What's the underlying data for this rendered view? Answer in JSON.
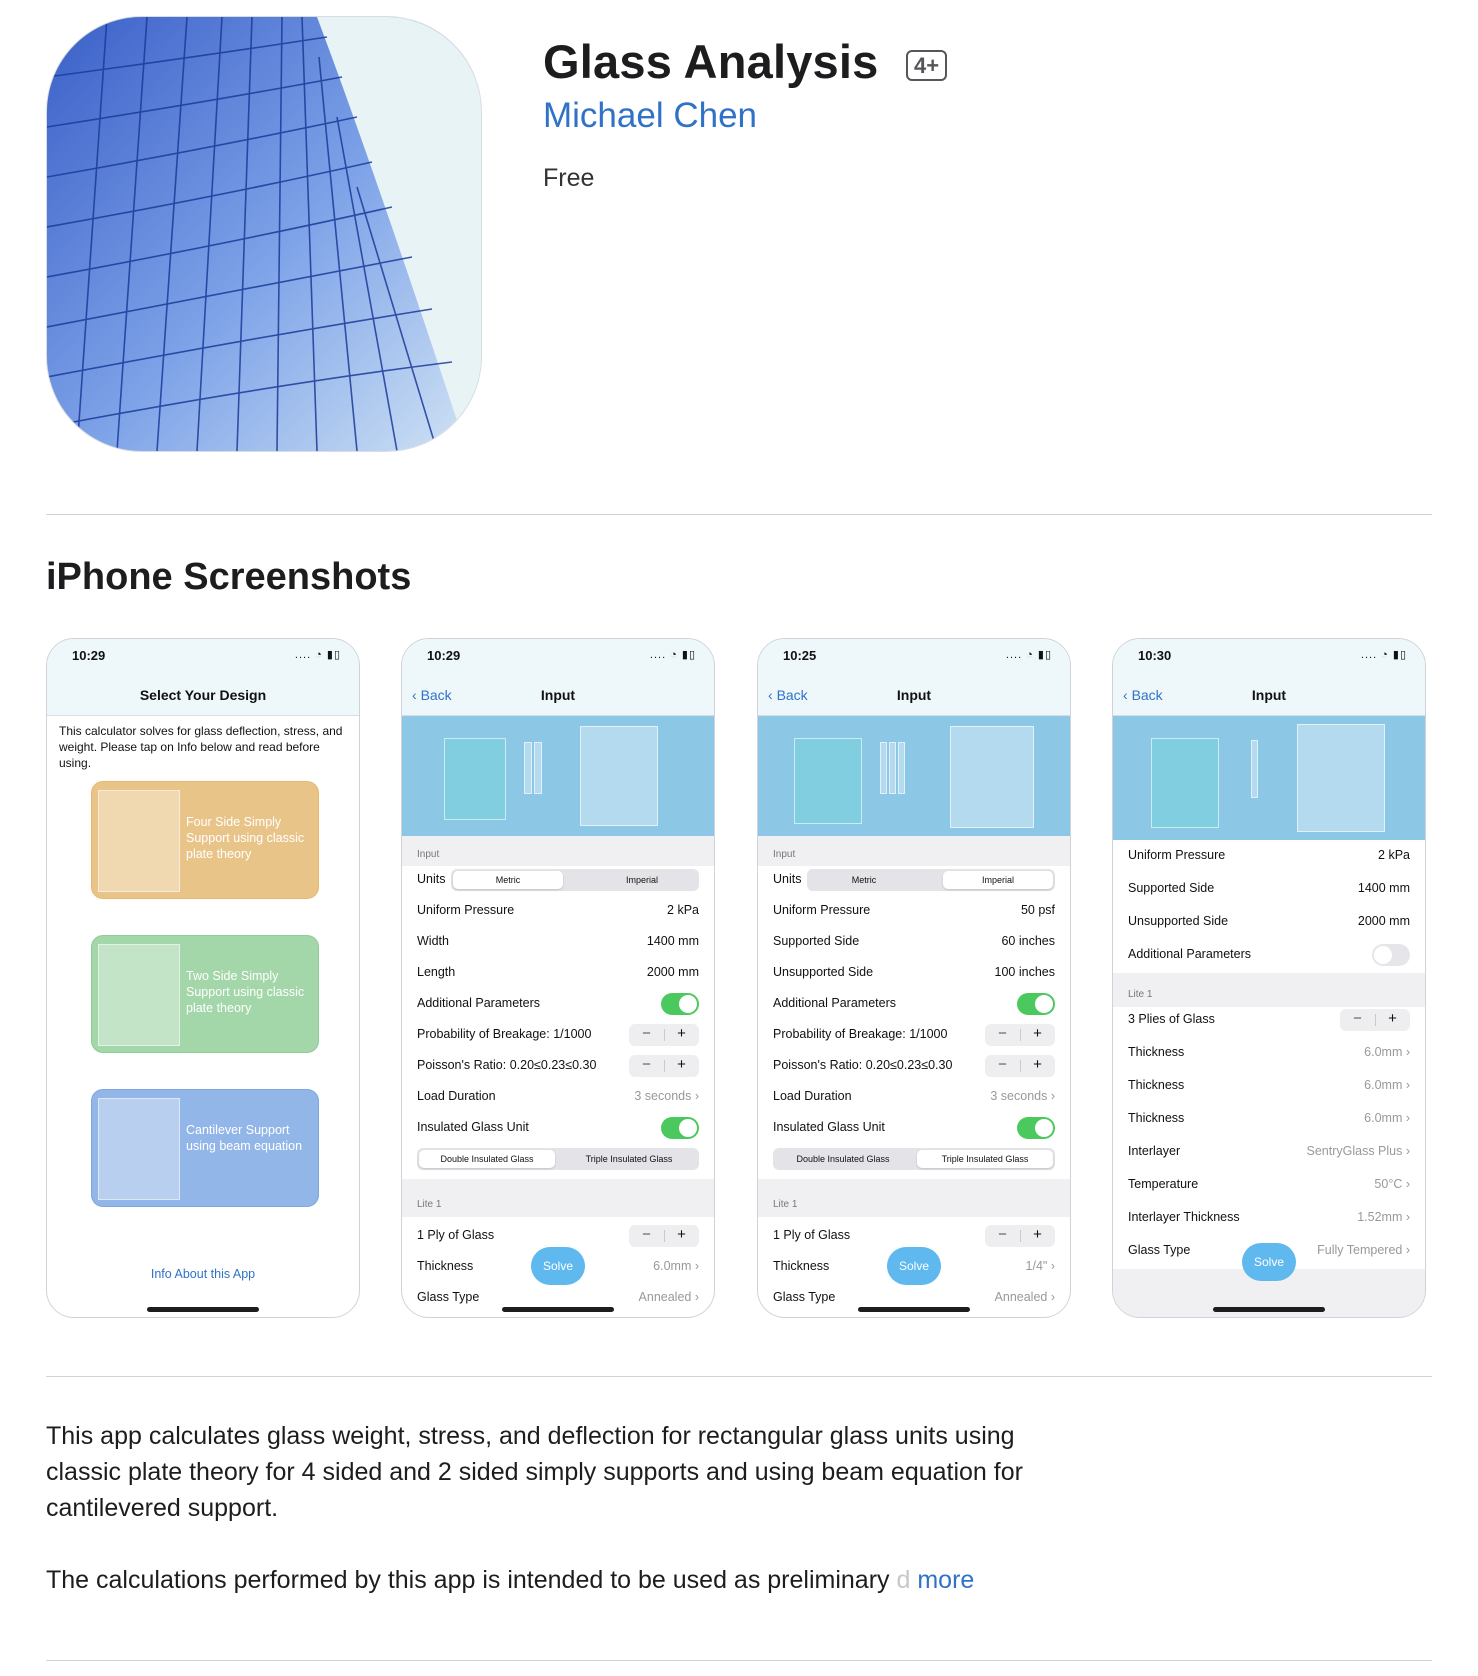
{
  "app": {
    "title": "Glass Analysis",
    "age_rating": "4+",
    "developer": "Michael Chen",
    "price": "Free"
  },
  "screenshots_section": {
    "title": "iPhone Screenshots"
  },
  "phones": [
    {
      "time": "10:29",
      "nav_title": "Select Your Design",
      "intro": "This calculator solves for glass deflection, stress, and weight. Please tap on Info below and read before using.",
      "cards": [
        "Four Side Simply Support using classic plate theory",
        "Two Side Simply Support using classic plate theory",
        "Cantilever Support using beam equation"
      ],
      "info_link": "Info About this App"
    },
    {
      "time": "10:29",
      "back": "Back",
      "nav_title": "Input",
      "section_input": "Input",
      "units_label": "Units",
      "seg_metric": "Metric",
      "seg_imperial": "Imperial",
      "uniform_pressure": "Uniform Pressure",
      "uniform_pressure_val": "2  kPa",
      "width": "Width",
      "width_val": "1400  mm",
      "length": "Length",
      "length_val": "2000  mm",
      "additional": "Additional Parameters",
      "prob": "Probability of Breakage: 1/1000",
      "poisson": "Poisson's Ratio: 0.20≤0.23≤0.30",
      "load": "Load Duration",
      "load_val": "3 seconds",
      "igu": "Insulated Glass Unit",
      "seg_double": "Double Insulated Glass",
      "seg_triple": "Triple Insulated Glass",
      "lite": "Lite 1",
      "ply": "1  Ply of Glass",
      "thickness": "Thickness",
      "thickness_val": "6.0mm",
      "glass_type": "Glass Type",
      "glass_type_val": "Annealed",
      "solve": "Solve"
    },
    {
      "time": "10:25",
      "back": "Back",
      "nav_title": "Input",
      "section_input": "Input",
      "units_label": "Units",
      "seg_metric": "Metric",
      "seg_imperial": "Imperial",
      "uniform_pressure": "Uniform Pressure",
      "uniform_pressure_val": "50  psf",
      "width": "Supported Side",
      "width_val": "60  inches",
      "length": "Unsupported Side",
      "length_val": "100  inches",
      "additional": "Additional Parameters",
      "prob": "Probability of Breakage: 1/1000",
      "poisson": "Poisson's Ratio: 0.20≤0.23≤0.30",
      "load": "Load Duration",
      "load_val": "3 seconds",
      "igu": "Insulated Glass Unit",
      "seg_double": "Double Insulated Glass",
      "seg_triple": "Triple Insulated Glass",
      "lite": "Lite 1",
      "ply": "1  Ply of Glass",
      "thickness": "Thickness",
      "thickness_val": "1/4\"",
      "glass_type": "Glass Type",
      "glass_type_val": "Annealed",
      "solve": "Solve"
    },
    {
      "time": "10:30",
      "back": "Back",
      "nav_title": "Input",
      "uniform_pressure": "Uniform Pressure",
      "uniform_pressure_val": "2  kPa",
      "supported": "Supported Side",
      "supported_val": "1400  mm",
      "unsupported": "Unsupported Side",
      "unsupported_val": "2000  mm",
      "additional": "Additional Parameters",
      "lite": "Lite 1",
      "plies": "3  Plies of Glass",
      "thickness": "Thickness",
      "thickness_val": "6.0mm",
      "interlayer": "Interlayer",
      "interlayer_val": "SentryGlass Plus",
      "temperature": "Temperature",
      "temperature_val": "50°C",
      "interlayer_thickness": "Interlayer Thickness",
      "interlayer_thickness_val": "1.52mm",
      "glass_type": "Glass Type",
      "glass_type_val": "Fully Tempered",
      "solve": "Solve"
    }
  ],
  "description": {
    "paragraph1": "This app calculates glass weight, stress, and deflection for rectangular glass units using classic plate theory for 4 sided and 2 sided simply supports and using beam equation for cantilevered support.",
    "paragraph2": "The calculations performed by this app is intended to be used as preliminary",
    "paragraph2_fade": "d",
    "more": "more"
  },
  "colors": {
    "accent": "#2f72c8",
    "toggle_on": "#4cc95e",
    "banner": "#8cc7e6",
    "solve": "#5fb9ee"
  }
}
